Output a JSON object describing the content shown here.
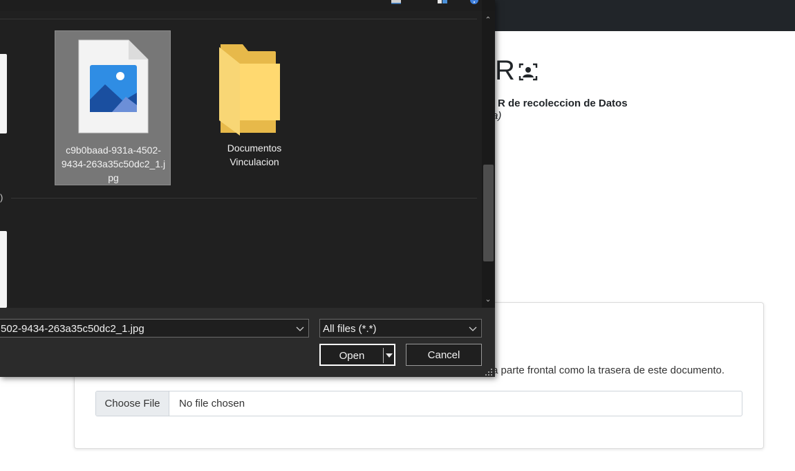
{
  "background_page": {
    "heading_partial": "R",
    "heading_icon": "person-id-card-icon",
    "subtitle": "R de recoleccion de Datos",
    "subtitle_line2": "a)",
    "instructions": "a parte frontal como la trasera de este documento.",
    "file_input": {
      "button_label": "Choose File",
      "status": "No file chosen"
    }
  },
  "file_dialog": {
    "files": [
      {
        "name": "c9b0baad-931a-4502-9434-263a35c50dc2_1.jpg",
        "name_lines": [
          "c9b0baad-931a-4502-",
          "9434-263a35c50dc2_1.j",
          "pg"
        ],
        "type": "image-file-icon",
        "selected": true
      },
      {
        "name": "Documentos Vinculacion",
        "name_lines": [
          "Documentos",
          "Vinculacion"
        ],
        "type": "folder-icon",
        "selected": false
      }
    ],
    "group_label_partial": ")",
    "filename_value": "502-9434-263a35c50dc2_1.jpg",
    "filetype_value": "All files (*.*)",
    "open_label": "Open",
    "cancel_label": "Cancel"
  },
  "colors": {
    "dialog_bg": "#202020",
    "dialog_bottom_bg": "#2b2b2b",
    "selection_bg": "#777777",
    "page_topbar": "#212529",
    "folder_yellow": "#f6c94e"
  }
}
